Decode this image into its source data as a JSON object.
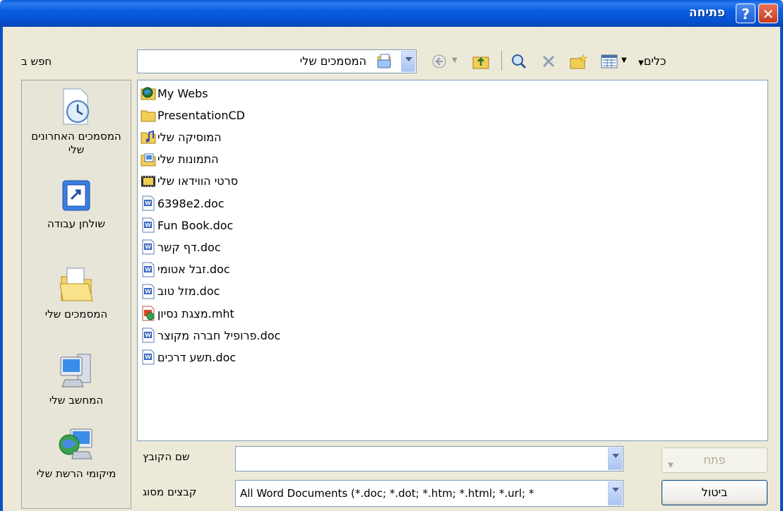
{
  "window": {
    "title": "פתיחה",
    "help_label": "?",
    "close_label": "✕"
  },
  "toolbar": {
    "lookin_label": "חפש ב",
    "lookin_value": "המסמכים שלי",
    "tools_label": "כלים"
  },
  "places": [
    {
      "label": "המסמכים האחרונים שלי",
      "icon": "recent-documents-icon"
    },
    {
      "label": "שולחן עבודה",
      "icon": "desktop-icon"
    },
    {
      "label": "המסמכים שלי",
      "icon": "my-documents-icon"
    },
    {
      "label": "המחשב שלי",
      "icon": "my-computer-icon"
    },
    {
      "label": "מיקומי הרשת שלי",
      "icon": "network-places-icon"
    }
  ],
  "files": [
    {
      "name": "My Webs",
      "icon": "web-folder-icon"
    },
    {
      "name": "PresentationCD",
      "icon": "folder-icon"
    },
    {
      "name": "המוסיקה שלי",
      "icon": "music-folder-icon"
    },
    {
      "name": "התמונות שלי",
      "icon": "pictures-folder-icon"
    },
    {
      "name": "סרטי הווידאו שלי",
      "icon": "video-folder-icon"
    },
    {
      "name": "6398e2.doc",
      "icon": "word-document-icon"
    },
    {
      "name": "Fun Book.doc",
      "icon": "word-document-icon"
    },
    {
      "name": "דף קשר.doc",
      "icon": "word-document-icon"
    },
    {
      "name": "זבל אטומי.doc",
      "icon": "word-document-icon"
    },
    {
      "name": "מזל טוב.doc",
      "icon": "word-document-icon"
    },
    {
      "name": "מצגת נסיון.mht",
      "icon": "mht-document-icon"
    },
    {
      "name": "פרופיל חברה מקוצר.doc",
      "icon": "word-document-icon"
    },
    {
      "name": "תשע דרכים.doc",
      "icon": "word-document-icon"
    }
  ],
  "bottom": {
    "filename_label": "שם הקובץ",
    "filename_value": "",
    "filetype_label": "קבצים מסוג",
    "filetype_value": "All Word Documents (*.doc; *.dot; *.htm; *.html; *.url; *",
    "open_label": "פתח",
    "cancel_label": "ביטול"
  }
}
